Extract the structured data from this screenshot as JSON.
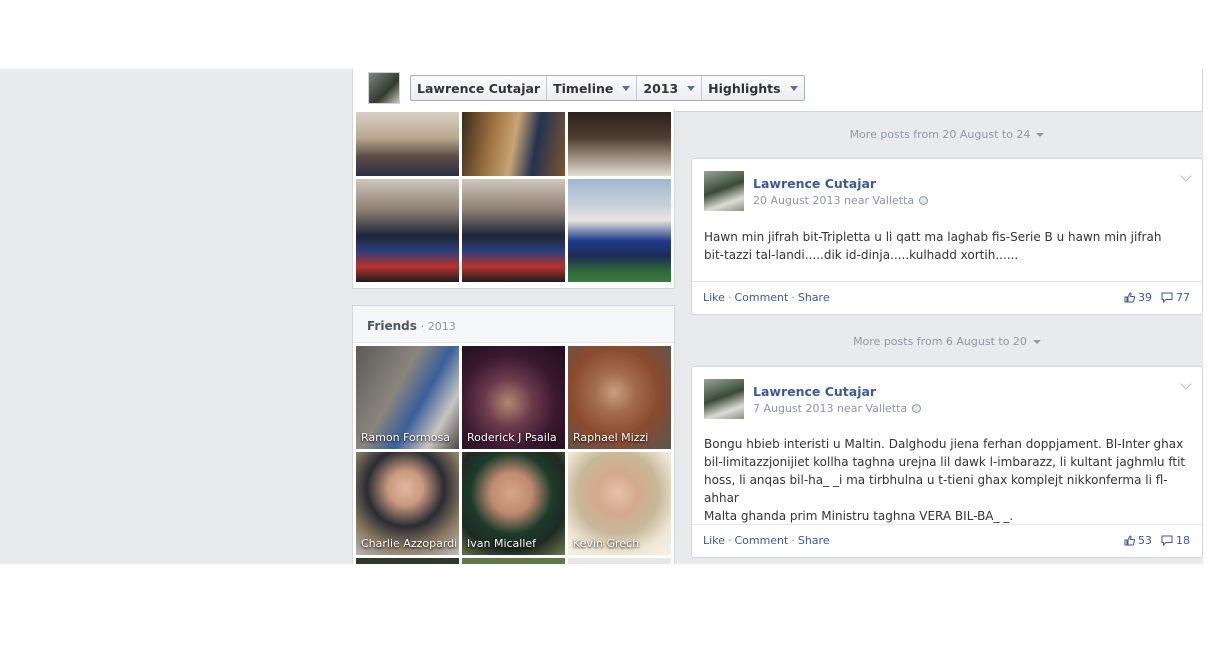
{
  "header": {
    "name": "Lawrence Cutajar",
    "timeline": "Timeline",
    "year": "2013",
    "highlights": "Highlights"
  },
  "friends": {
    "title": "Friends",
    "year": "· 2013",
    "items": [
      {
        "name": "Ramon Formosa"
      },
      {
        "name": "Roderick J Psaila"
      },
      {
        "name": "Raphael Mizzi"
      },
      {
        "name": "Charlie Azzopardi"
      },
      {
        "name": "Ivan Micallef"
      },
      {
        "name": "Kevin Grech"
      }
    ]
  },
  "more_posts": [
    {
      "label": "More posts from 20 August to 24"
    },
    {
      "label": "More posts from 6 August to 20"
    }
  ],
  "posts": [
    {
      "author": "Lawrence Cutajar",
      "meta": "20 August 2013 near Valletta",
      "lines": [
        "Hawn min jifrah bit-Tripletta u li qatt ma laghab fis-Serie B u hawn min jifrah",
        "bit-tazzi tal-landi.....dik id-dinja.....kulhadd xortih......"
      ],
      "like": "Like",
      "comment": "Comment",
      "share": "Share",
      "likes": "39",
      "comments": "77"
    },
    {
      "author": "Lawrence Cutajar",
      "meta": "7 August 2013 near Valletta",
      "lines": [
        "Bongu hbieb interisti u Maltin. Dalghodu jiena ferhan doppjament. Bl-Inter ghax",
        "bil-limitazzjonijiet kollha taghna urejna lil dawk l-imbarazz, li kultant jaghmlu ftit",
        "hoss, li anqas bil-ha_ _i ma tirbhulna u t-tieni ghax komplejt nikkonferma li fl-ahhar",
        "Malta ghanda prim Ministru taghna VERA BIL-BA_ _."
      ],
      "like": "Like",
      "comment": "Comment",
      "share": "Share",
      "likes": "53",
      "comments": "18"
    }
  ],
  "icons": {
    "caret": "caret-down-icon",
    "globe": "globe-icon",
    "like": "thumbs-up-icon",
    "comment": "comment-icon",
    "chevron": "chevron-down-icon"
  },
  "colors": {
    "link": "#3b5998",
    "background": "#e9eaed",
    "muted": "#90949c"
  }
}
